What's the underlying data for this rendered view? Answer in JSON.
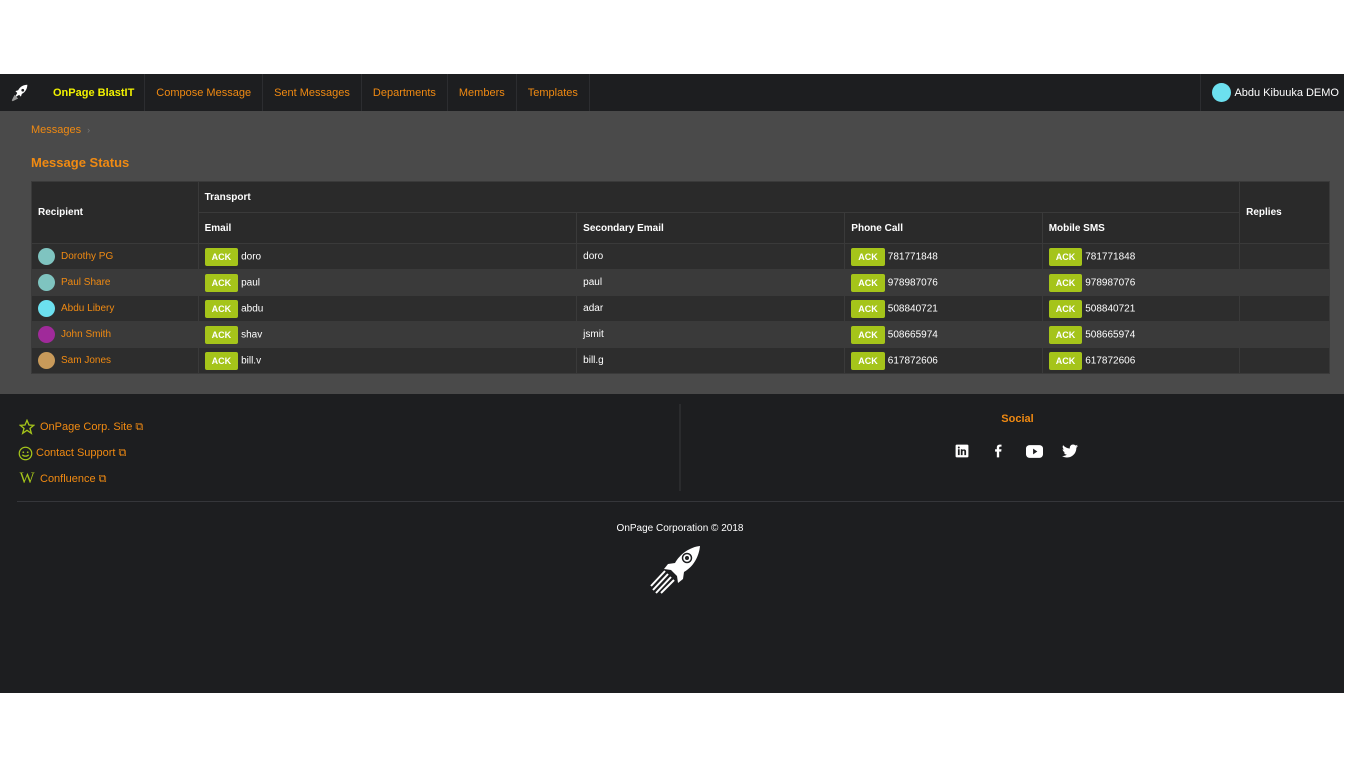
{
  "nav": {
    "brand": "OnPage BlastIT",
    "items": [
      "Compose Message",
      "Sent Messages",
      "Departments",
      "Members",
      "Templates"
    ],
    "user": "Abdu Kibuuka DEMO"
  },
  "breadcrumb": {
    "items": [
      "Messages"
    ]
  },
  "page_title": "Message Status",
  "table": {
    "headers": {
      "recipient": "Recipient",
      "transport": "Transport",
      "replies": "Replies",
      "email": "Email",
      "secondary_email": "Secondary Email",
      "phone_call": "Phone Call",
      "mobile_sms": "Mobile SMS"
    },
    "ack_label": "ACK",
    "rows": [
      {
        "name": "Dorothy PG",
        "avatar_color": "#7fc4c0",
        "email": "doro",
        "secondary": "doro",
        "phone": "781771848",
        "sms": "781771848",
        "replies": ""
      },
      {
        "name": "Paul Share",
        "avatar_color": "#7fc4c0",
        "email": "paul",
        "secondary": "paul",
        "phone": "978987076",
        "sms": "978987076",
        "replies": ""
      },
      {
        "name": "Abdu Libery",
        "avatar_color": "#6ce0ef",
        "email": "abdu",
        "secondary": "adar",
        "phone": "508840721",
        "sms": "508840721",
        "replies": ""
      },
      {
        "name": "John Smith",
        "avatar_color": "#a02a9a",
        "email": "shav",
        "secondary": "jsmit",
        "phone": "508665974",
        "sms": "508665974",
        "replies": ""
      },
      {
        "name": "Sam Jones",
        "avatar_color": "#c89a5a",
        "email": "bill.v",
        "secondary": "bill.g",
        "phone": "617872606",
        "sms": "617872606",
        "replies": ""
      }
    ]
  },
  "footer": {
    "links": [
      {
        "label": "OnPage Corp. Site",
        "icon": "star-icon"
      },
      {
        "label": "Contact Support",
        "icon": "smiley-icon"
      },
      {
        "label": "Confluence",
        "icon": "wikipedia-icon"
      }
    ],
    "social_title": "Social",
    "social": [
      "linkedin-icon",
      "facebook-icon",
      "youtube-icon",
      "twitter-icon"
    ],
    "copyright": "OnPage Corporation © 2018"
  },
  "colors": {
    "accent": "#f08a12",
    "brand": "#f2f200",
    "ack": "#a5c41a"
  }
}
